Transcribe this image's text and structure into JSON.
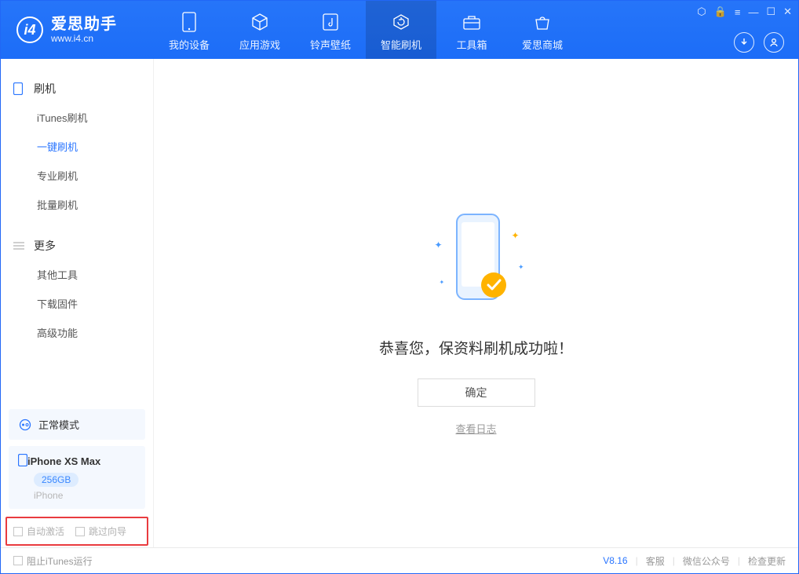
{
  "brand": {
    "name": "爱思助手",
    "site": "www.i4.cn"
  },
  "nav": [
    {
      "label": "我的设备",
      "icon": "device"
    },
    {
      "label": "应用游戏",
      "icon": "cube"
    },
    {
      "label": "铃声壁纸",
      "icon": "music"
    },
    {
      "label": "智能刷机",
      "icon": "refresh",
      "active": true
    },
    {
      "label": "工具箱",
      "icon": "toolbox"
    },
    {
      "label": "爱思商城",
      "icon": "store"
    }
  ],
  "sidebar": {
    "group1": {
      "title": "刷机",
      "items": [
        "iTunes刷机",
        "一键刷机",
        "专业刷机",
        "批量刷机"
      ],
      "activeIndex": 1
    },
    "group2": {
      "title": "更多",
      "items": [
        "其他工具",
        "下载固件",
        "高级功能"
      ]
    }
  },
  "device": {
    "mode": "正常模式",
    "name": "iPhone XS Max",
    "storage": "256GB",
    "type": "iPhone"
  },
  "checkboxes": {
    "autoActivate": "自动激活",
    "skipGuide": "跳过向导"
  },
  "main": {
    "message": "恭喜您，保资料刷机成功啦！",
    "okButton": "确定",
    "logLink": "查看日志"
  },
  "footer": {
    "blockItunes": "阻止iTunes运行",
    "version": "V8.16",
    "links": [
      "客服",
      "微信公众号",
      "检查更新"
    ]
  }
}
